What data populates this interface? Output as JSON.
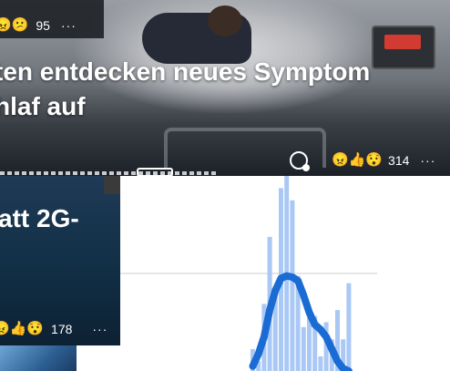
{
  "hero": {
    "title_line1": "ten entdecken neues Symptom",
    "title_line2": "hlaf auf",
    "top_reactions": {
      "emojis": "😠😕",
      "count": "95",
      "more": "···"
    },
    "bottom_reactions": {
      "emojis": "😠👍😯",
      "count": "314",
      "more": "···"
    }
  },
  "card2": {
    "title": "att 2G-",
    "reactions": {
      "emojis": "😠👍😯",
      "count": "178",
      "more": "···"
    }
  },
  "chart_data": {
    "type": "bar",
    "bar_color": "#aac8f5",
    "line_color": "#1a6bd4",
    "gridline_color": "#e6e6e6",
    "values": [
      18,
      8,
      55,
      110,
      62,
      150,
      160,
      140,
      78,
      36,
      44,
      45,
      12,
      40,
      26,
      50,
      26,
      72
    ],
    "trend": [
      4,
      14,
      28,
      50,
      66,
      76,
      78,
      77,
      74,
      62,
      48,
      38,
      34,
      28,
      18,
      8,
      2,
      0
    ],
    "ylim": [
      0,
      160
    ]
  }
}
